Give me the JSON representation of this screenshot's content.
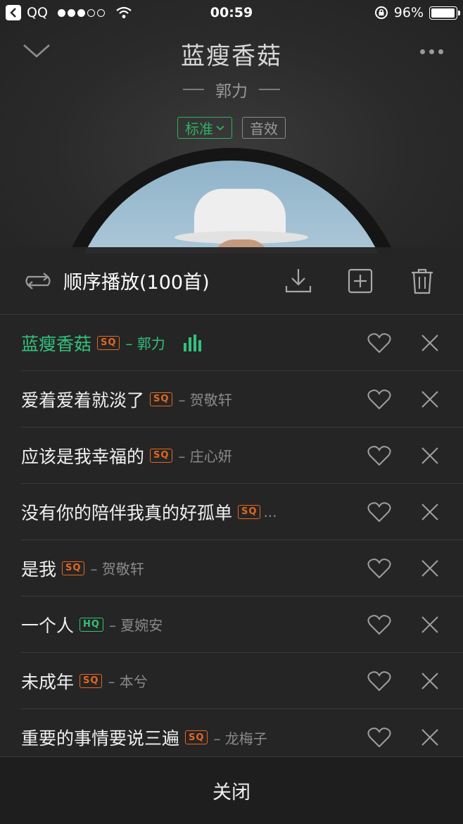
{
  "status_bar": {
    "carrier": "QQ",
    "time": "00:59",
    "battery": "96%",
    "battery_level": 0.96
  },
  "player": {
    "title": "蓝瘦香菇",
    "artist": "郭力",
    "quality_label": "标准",
    "effect_label": "音效"
  },
  "playlist": {
    "mode_label": "顺序播放(100首)",
    "songs": [
      {
        "name": "蓝瘦香菇",
        "badge": "SQ",
        "artist": "– 郭力"
      },
      {
        "name": "爱着爱着就淡了",
        "badge": "SQ",
        "artist": "– 贺敬轩"
      },
      {
        "name": "应该是我幸福的",
        "badge": "SQ",
        "artist": "– 庄心妍"
      },
      {
        "name": "没有你的陪伴我真的好孤单",
        "badge": "SQ",
        "artist": "..."
      },
      {
        "name": "是我",
        "badge": "SQ",
        "artist": "– 贺敬轩"
      },
      {
        "name": "一个人",
        "badge": "HQ",
        "artist": "– 夏婉安"
      },
      {
        "name": "未成年",
        "badge": "SQ",
        "artist": "– 本兮"
      },
      {
        "name": "重要的事情要说三遍",
        "badge": "SQ",
        "artist": "– 龙梅子"
      }
    ],
    "close_label": "关闭"
  },
  "colors": {
    "accent_green": "#31c27c",
    "sq_orange": "#e2691c",
    "sheet_bg": "#262526"
  },
  "icons": {
    "mode": "repeat-icon",
    "download": "download-icon",
    "add": "add-to-playlist-icon",
    "delete": "trash-icon",
    "like": "heart-icon",
    "remove": "close-icon",
    "playing": "equalizer-icon"
  }
}
